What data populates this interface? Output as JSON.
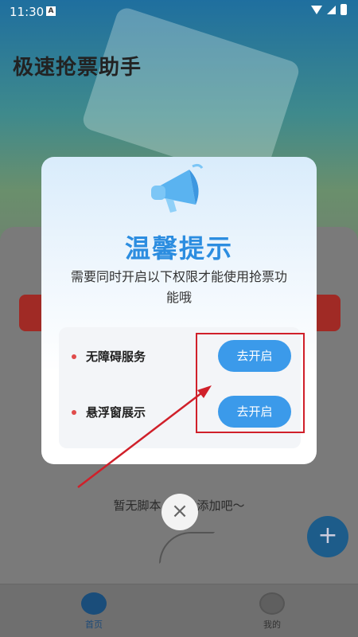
{
  "status_bar": {
    "time": "11:30",
    "a_badge": "A"
  },
  "app": {
    "title": "极速抢票助手",
    "empty_text": "暂无脚本，快去添加吧～",
    "fab_icon": "+",
    "tabs": [
      {
        "label": "首页",
        "icon": "home-icon"
      },
      {
        "label": "我的",
        "icon": "profile-icon"
      }
    ]
  },
  "dialog": {
    "icon": "megaphone-icon",
    "title": "温馨提示",
    "description": "需要同时开启以下权限才能使用抢票功能哦",
    "permissions": [
      {
        "label": "无障碍服务",
        "button": "去开启"
      },
      {
        "label": "悬浮窗展示",
        "button": "去开启"
      }
    ],
    "close_icon": "×"
  },
  "colors": {
    "accent": "#2c8de0",
    "button": "#3b9aea",
    "annotation": "#d0202a"
  }
}
